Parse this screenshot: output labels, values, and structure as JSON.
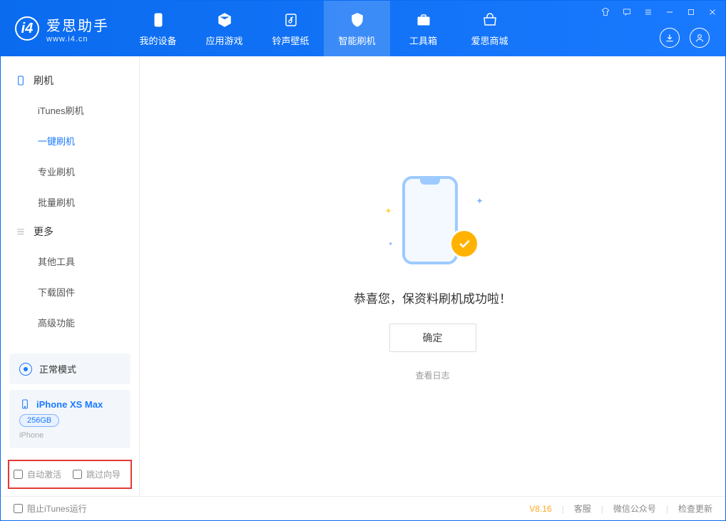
{
  "logo": {
    "name": "爱思助手",
    "url": "www.i4.cn"
  },
  "nav": {
    "items": [
      {
        "label": "我的设备"
      },
      {
        "label": "应用游戏"
      },
      {
        "label": "铃声壁纸"
      },
      {
        "label": "智能刷机"
      },
      {
        "label": "工具箱"
      },
      {
        "label": "爱思商城"
      }
    ]
  },
  "sidebar": {
    "section1": {
      "title": "刷机",
      "items": [
        "iTunes刷机",
        "一键刷机",
        "专业刷机",
        "批量刷机"
      ]
    },
    "section2": {
      "title": "更多",
      "items": [
        "其他工具",
        "下载固件",
        "高级功能"
      ]
    },
    "mode": "正常模式",
    "device": {
      "name": "iPhone XS Max",
      "storage": "256GB",
      "type": "iPhone"
    },
    "options": {
      "auto_activate": "自动激活",
      "skip_guide": "跳过向导"
    }
  },
  "main": {
    "success_msg": "恭喜您，保资料刷机成功啦！",
    "confirm": "确定",
    "view_log": "查看日志"
  },
  "footer": {
    "block_itunes": "阻止iTunes运行",
    "version": "V8.16",
    "links": [
      "客服",
      "微信公众号",
      "检查更新"
    ]
  }
}
